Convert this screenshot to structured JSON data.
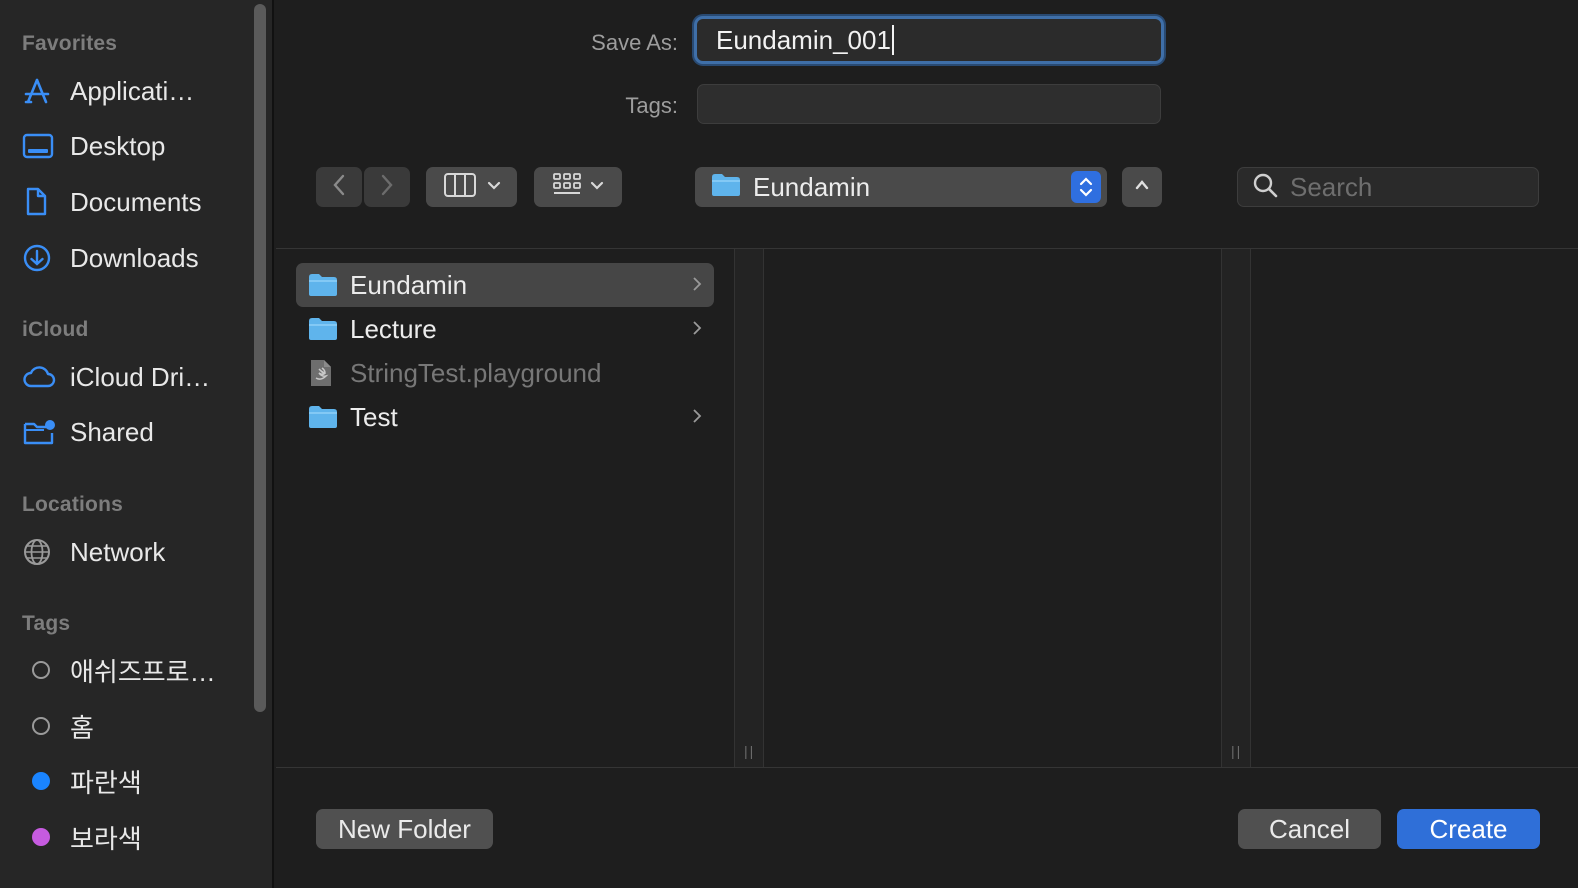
{
  "sidebar": {
    "sections": {
      "favorites": "Favorites",
      "icloud": "iCloud",
      "locations": "Locations",
      "tags": "Tags"
    },
    "favorites": [
      {
        "label": "Applicati…",
        "icon": "applications-icon"
      },
      {
        "label": "Desktop",
        "icon": "desktop-icon"
      },
      {
        "label": "Documents",
        "icon": "document-icon"
      },
      {
        "label": "Downloads",
        "icon": "downloads-icon"
      }
    ],
    "icloud": [
      {
        "label": "iCloud Dri…",
        "icon": "cloud-icon"
      },
      {
        "label": "Shared",
        "icon": "shared-folder-icon"
      }
    ],
    "locations": [
      {
        "label": "Network",
        "icon": "globe-icon"
      }
    ],
    "tags": [
      {
        "label": "애쉬즈프로…",
        "color": ""
      },
      {
        "label": "홈",
        "color": ""
      },
      {
        "label": "파란색",
        "color": "#1a84ff"
      },
      {
        "label": "보라색",
        "color": "#c65be0"
      }
    ]
  },
  "form": {
    "save_as_label": "Save As:",
    "save_as_value": "Eundamin_001",
    "tags_label": "Tags:",
    "tags_value": ""
  },
  "toolbar": {
    "path_folder": "Eundamin",
    "search_placeholder": "Search"
  },
  "browser": {
    "items": [
      {
        "name": "Eundamin",
        "type": "folder",
        "selected": true,
        "has_children": true
      },
      {
        "name": "Lecture",
        "type": "folder",
        "selected": false,
        "has_children": true
      },
      {
        "name": "StringTest.playground",
        "type": "playground",
        "selected": false,
        "has_children": false
      },
      {
        "name": "Test",
        "type": "folder",
        "selected": false,
        "has_children": true
      }
    ]
  },
  "buttons": {
    "new_folder": "New Folder",
    "cancel": "Cancel",
    "create": "Create"
  },
  "colors": {
    "accent": "#2f6fd8",
    "folder": "#5fb4ec"
  }
}
